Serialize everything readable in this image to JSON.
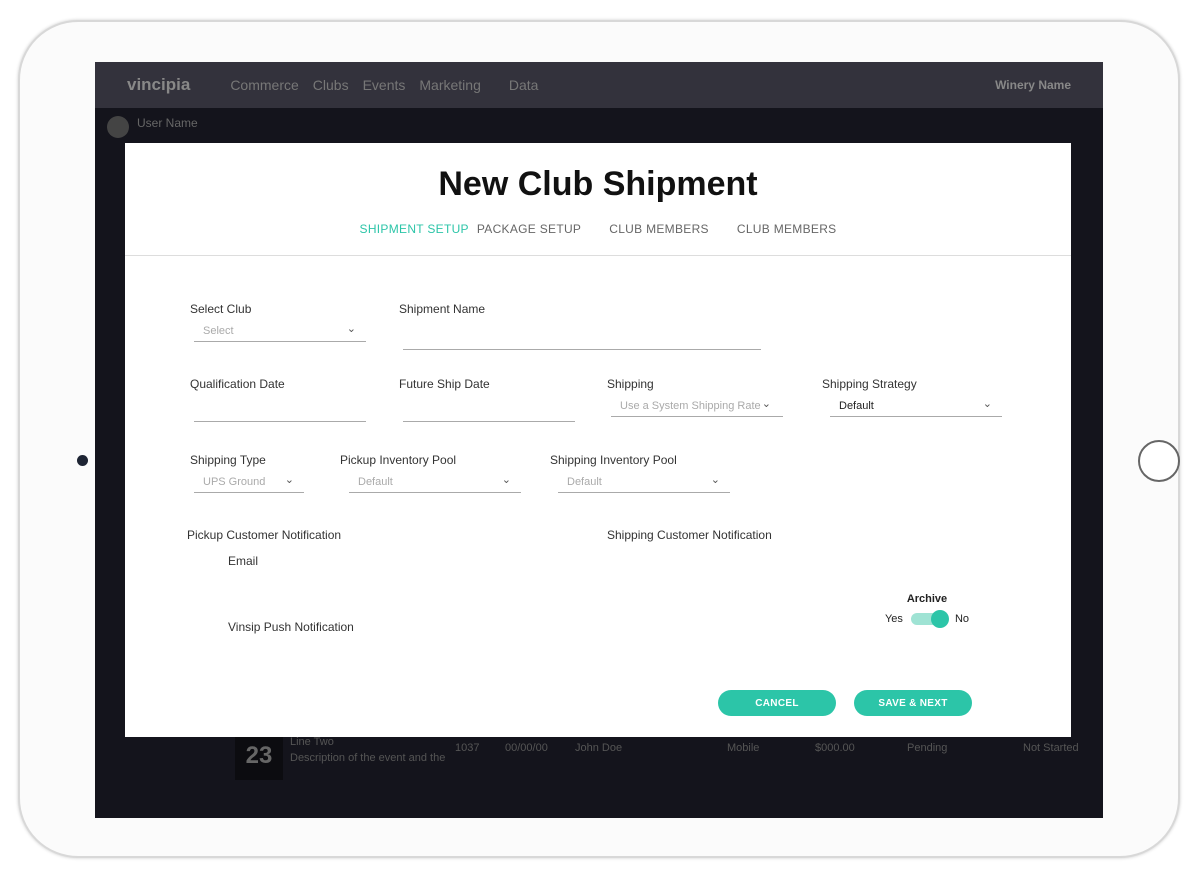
{
  "nav": {
    "logo": "vincipia",
    "items": [
      "Commerce",
      "Clubs",
      "Events",
      "Marketing",
      "Data"
    ],
    "winery": "Winery Name"
  },
  "user": {
    "name": "User Name"
  },
  "background_row": {
    "day": "23",
    "title": "Line Two",
    "description": "Description of the event and the",
    "id": "1037",
    "date": "00/00/00",
    "customer": "John Doe",
    "type": "Mobile",
    "amount": "$000.00",
    "status": "Pending",
    "progress": "Not Started"
  },
  "modal": {
    "title": "New Club Shipment",
    "tabs": [
      {
        "label": "SHIPMENT SETUP",
        "active": true
      },
      {
        "label": "PACKAGE SETUP"
      },
      {
        "label": "CLUB MEMBERS"
      },
      {
        "label": "CLUB MEMBERS"
      }
    ],
    "fields": {
      "select_club": {
        "label": "Select Club",
        "placeholder": "Select"
      },
      "shipment_name": {
        "label": "Shipment Name",
        "value": ""
      },
      "qualification_date": {
        "label": "Qualification Date",
        "value": ""
      },
      "future_ship_date": {
        "label": "Future Ship Date",
        "value": ""
      },
      "shipping": {
        "label": "Shipping",
        "value": "Use a System Shipping Rate"
      },
      "shipping_strategy": {
        "label": "Shipping Strategy",
        "value": "Default"
      },
      "shipping_type": {
        "label": "Shipping Type",
        "value": "UPS Ground"
      },
      "pickup_pool": {
        "label": "Pickup Inventory Pool",
        "value": "Default"
      },
      "shipping_pool": {
        "label": "Shipping Inventory Pool",
        "value": "Default"
      }
    },
    "pickup_notification": "Pickup Customer Notification",
    "shipping_notification": "Shipping Customer Notification",
    "email": "Email",
    "push": "Vinsip Push Notification",
    "archive": {
      "label": "Archive",
      "yes": "Yes",
      "no": "No",
      "state": "No"
    },
    "cancel": "CANCEL",
    "save": "SAVE & NEXT"
  },
  "colors": {
    "accent": "#2cc5a8"
  }
}
